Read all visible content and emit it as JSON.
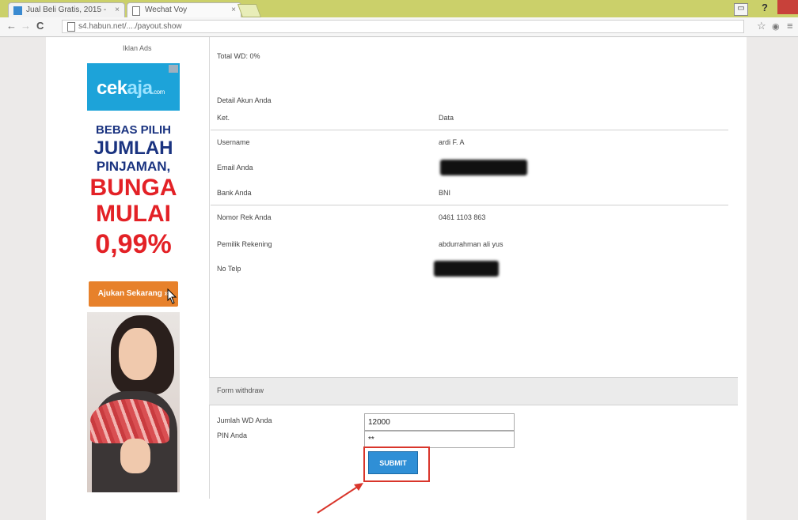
{
  "browser": {
    "tabs": [
      {
        "label": "Jual Beli Gratis, 2015 -",
        "active": false
      },
      {
        "label": "Wechat Voy",
        "active": true
      }
    ],
    "url": "s4.habun.net/..../payout.show"
  },
  "sidebar_ad": {
    "caption": "Iklan Ads",
    "brand_main": "cek",
    "brand_accent": "aja",
    "brand_suffix": ".com",
    "line1": "BEBAS PILIH",
    "line2": "JUMLAH",
    "line3": "PINJAMAN,",
    "line4": "BUNGA",
    "line5": "MULAI",
    "line6": "0,99%",
    "button": "Ajukan Sekarang »"
  },
  "details": {
    "top_label": "Total WD: 0%",
    "section_title": "Detail Akun Anda",
    "col_key": "Ket.",
    "col_val": "Data",
    "rows": [
      {
        "key": "Username",
        "value": "ardi F. A"
      },
      {
        "key": "Email Anda",
        "value": ""
      },
      {
        "key": "Bank Anda",
        "value": "BNI"
      },
      {
        "key": "Nomor Rek Anda",
        "value": "0461 1103 863"
      },
      {
        "key": "Pemilik Rekening",
        "value": "abdurrahman ali yus"
      },
      {
        "key": "No Telp",
        "value": ""
      }
    ]
  },
  "form": {
    "header": "Form withdraw",
    "amount_label": "Jumlah WD Anda",
    "amount_value": "12000",
    "pin_label": "PIN Anda",
    "pin_value": "**",
    "submit": "SUBMIT"
  },
  "colors": {
    "tabbar": "#cbd06a",
    "submit": "#2f8fd6",
    "highlight": "#d9352b",
    "ad_blue": "#1da3d9",
    "ad_red": "#e32126"
  }
}
